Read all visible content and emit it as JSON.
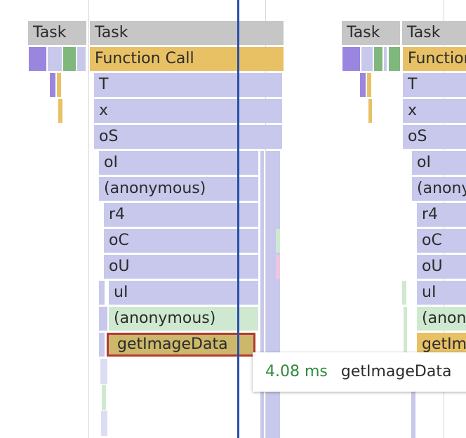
{
  "flame_chart": {
    "left": {
      "task_small": "Task",
      "task": "Task",
      "function_call": "Function Call",
      "frames": [
        "T",
        "x",
        "oS",
        "oI",
        "(anonymous)",
        "r4",
        "oC",
        "oU",
        "uI",
        "(anonymous)"
      ],
      "selected": "getImageData"
    },
    "right": {
      "task_small": "Task",
      "task": "Task",
      "function_call": "Function Call",
      "frames": [
        "T",
        "x",
        "oS",
        "oI",
        "(anonymous)",
        "r4",
        "oC",
        "oU",
        "uI",
        "(anonymous)",
        "getImageData"
      ]
    }
  },
  "tooltip": {
    "duration": "4.08 ms",
    "name": "getImageData"
  },
  "colors": {
    "task": "#c6c6c6",
    "function_call": "#e8c165",
    "frame": "#c7c8eb",
    "anonymous": "#cfe9d1",
    "selected": "#ccb76a",
    "selected_border": "#b23a34",
    "cursor": "#2a4fa8",
    "duration_text": "#2f8a3c"
  }
}
